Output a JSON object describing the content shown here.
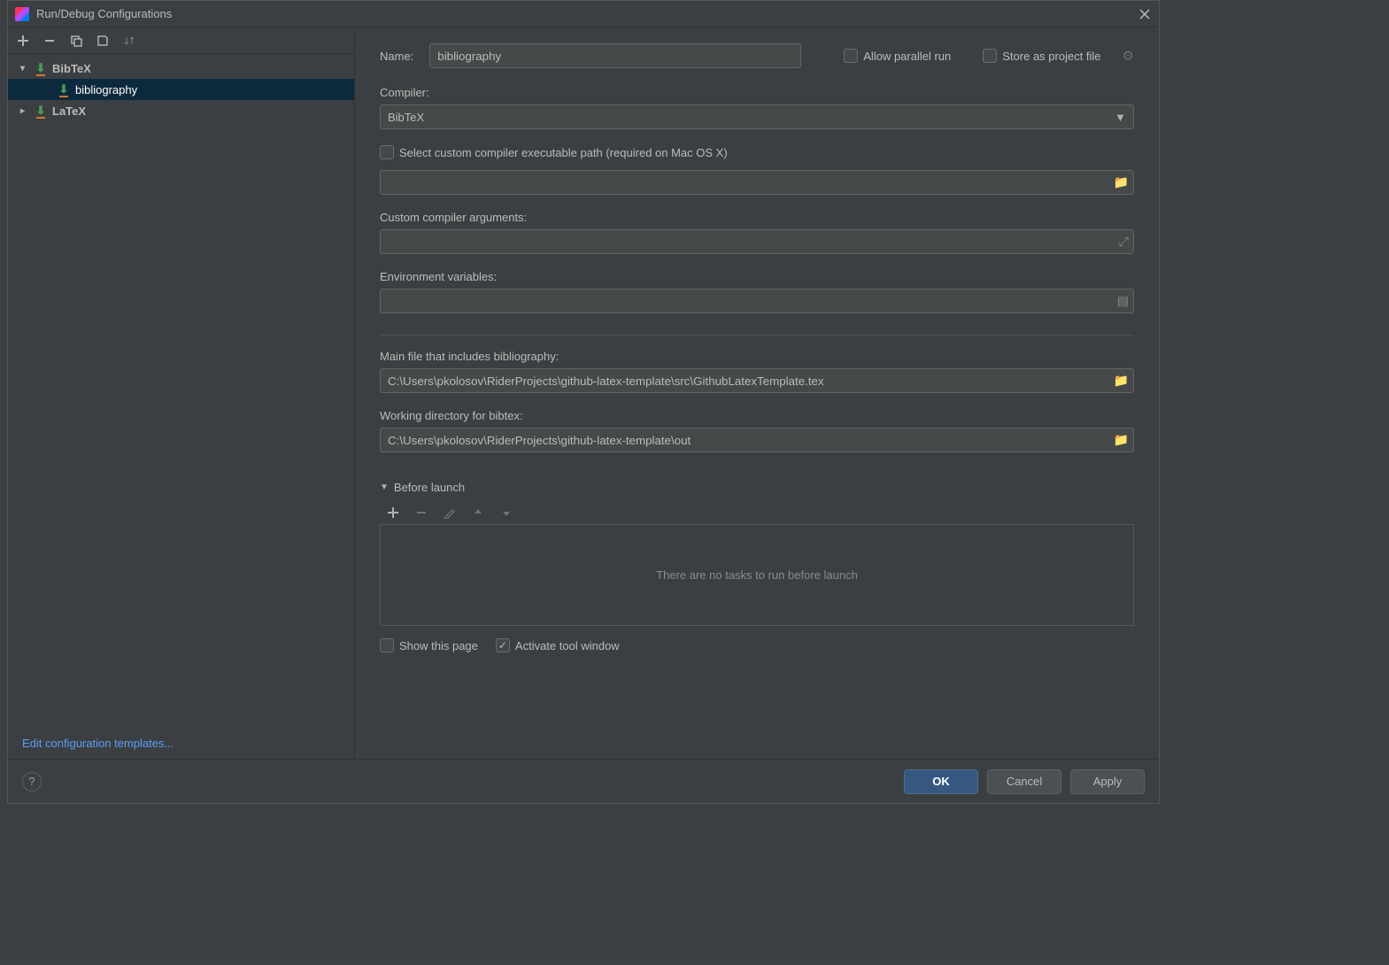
{
  "title": "Run/Debug Configurations",
  "sidebar": {
    "nodes": [
      {
        "label": "BibTeX",
        "expanded": true
      },
      {
        "label": "bibliography",
        "selected": true
      },
      {
        "label": "LaTeX",
        "expanded": false
      }
    ],
    "edit_templates": "Edit configuration templates..."
  },
  "form": {
    "name_label": "Name:",
    "name_value": "bibliography",
    "allow_parallel": "Allow parallel run",
    "store_project": "Store as project file",
    "compiler_label": "Compiler:",
    "compiler_value": "BibTeX",
    "custom_compiler_cb": "Select custom compiler executable path (required on Mac OS X)",
    "custom_compiler_path": "",
    "custom_args_label": "Custom compiler arguments:",
    "custom_args_value": "",
    "env_label": "Environment variables:",
    "env_value": "",
    "mainfile_label": "Main file that includes bibliography:",
    "mainfile_value": "C:\\Users\\pkolosov\\RiderProjects\\github-latex-template\\src\\GithubLatexTemplate.tex",
    "workdir_label": "Working directory for bibtex:",
    "workdir_value": "C:\\Users\\pkolosov\\RiderProjects\\github-latex-template\\out",
    "before_launch": "Before launch",
    "no_tasks": "There are no tasks to run before launch",
    "show_page": "Show this page",
    "activate_tool": "Activate tool window"
  },
  "footer": {
    "ok": "OK",
    "cancel": "Cancel",
    "apply": "Apply"
  }
}
